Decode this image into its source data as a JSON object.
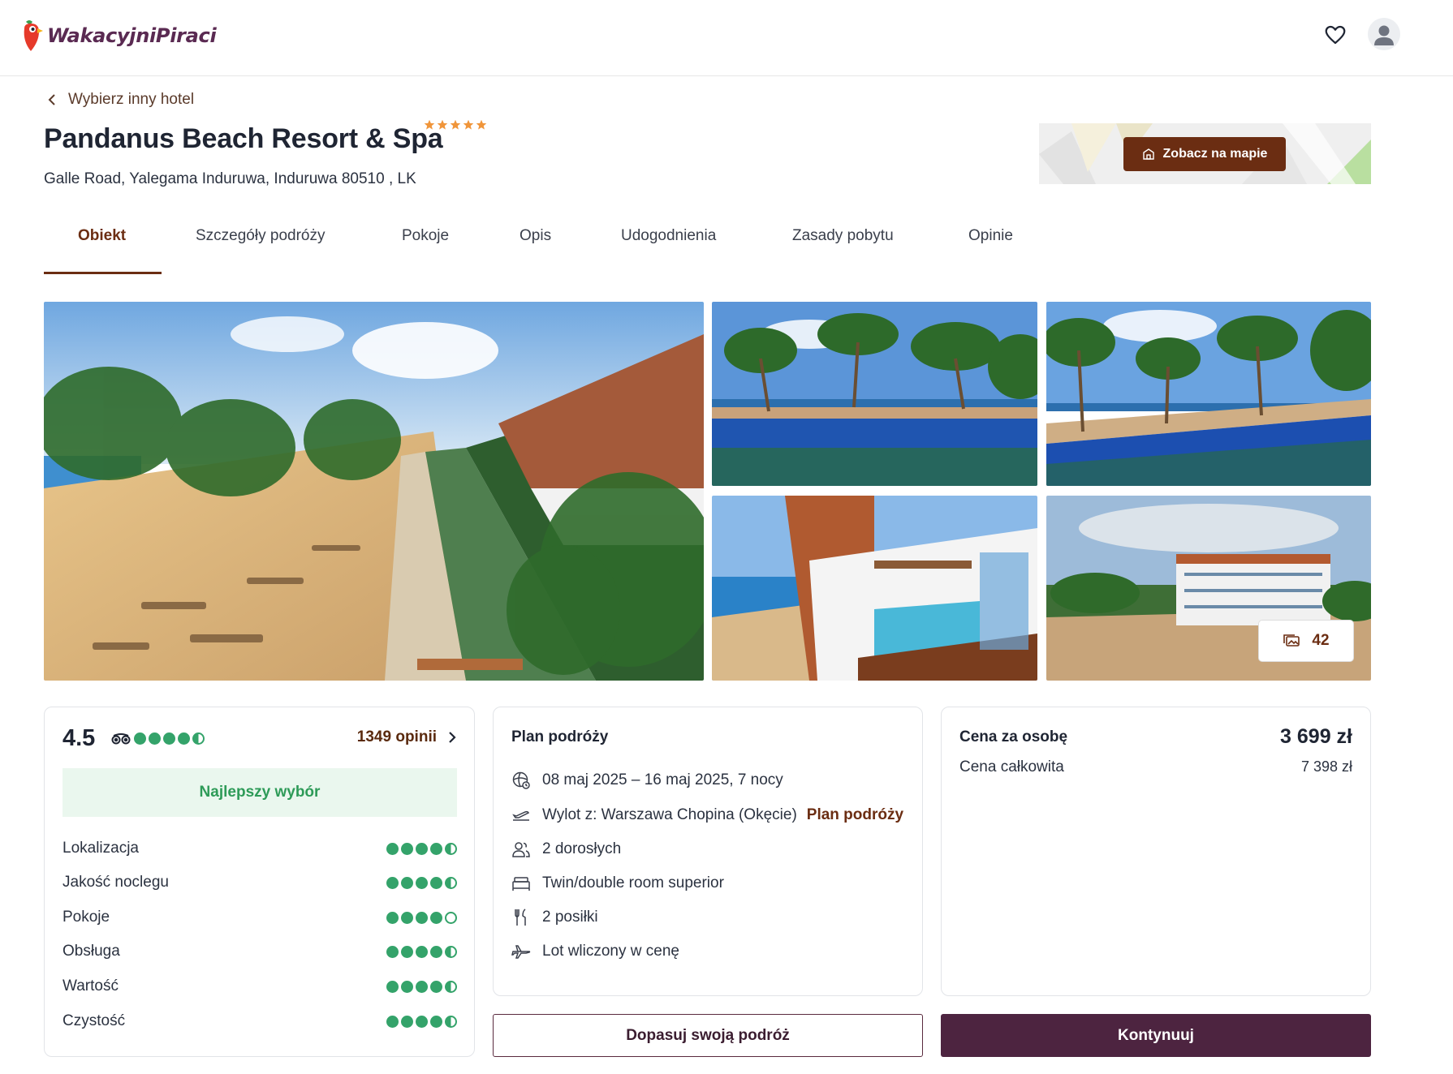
{
  "header": {
    "logo_text": "WakacyjniPiraci",
    "icons": {
      "favorites": "heart-icon",
      "account": "user-avatar-icon"
    }
  },
  "hotel": {
    "back_label": "Wybierz inny hotel",
    "name": "Pandanus Beach Resort & Spa",
    "stars": 5,
    "address": "Galle Road, Yalegama Induruwa, Induruwa 80510 , LK",
    "map_button_label": "Zobacz na mapie"
  },
  "tabs": [
    {
      "label": "Obiekt",
      "active": true
    },
    {
      "label": "Szczegóły podróży",
      "active": false
    },
    {
      "label": "Pokoje",
      "active": false
    },
    {
      "label": "Opis",
      "active": false
    },
    {
      "label": "Udogodnienia",
      "active": false
    },
    {
      "label": "Zasady pobytu",
      "active": false
    },
    {
      "label": "Opinie",
      "active": false
    }
  ],
  "gallery": {
    "photo_count": "42",
    "photos": [
      "beach-pool-aerial",
      "infinity-pool-palms-1",
      "infinity-pool-palms-2",
      "balcony-plunge-pool",
      "hotel-building-aerial"
    ]
  },
  "rating": {
    "score": "4.5",
    "tripadvisor_bubbles": 4.5,
    "reviews_count": "1349 opinii",
    "badge": "Najlepszy wybór",
    "categories": [
      {
        "label": "Lokalizacja",
        "value": 4.5
      },
      {
        "label": "Jakość noclegu",
        "value": 4.5
      },
      {
        "label": "Pokoje",
        "value": 4
      },
      {
        "label": "Obsługa",
        "value": 4.5
      },
      {
        "label": "Wartość",
        "value": 4.5
      },
      {
        "label": "Czystość",
        "value": 4.5
      }
    ]
  },
  "plan": {
    "title": "Plan podróży",
    "dates": "08 maj 2025 – 16 maj 2025, 7 nocy",
    "departure": "Wylot z: Warszawa Chopina (Okęcie)",
    "departure_link": "Plan podróży",
    "travelers": "2 dorosłych",
    "room": "Twin/double room superior",
    "meals": "2 posiłki",
    "flight": "Lot wliczony w cenę"
  },
  "price": {
    "per_person_label": "Cena za osobę",
    "per_person_value": "3 699 zł",
    "total_label": "Cena całkowita",
    "total_value": "7 398 zł"
  },
  "actions": {
    "customize_label": "Dopasuj swoją podróż",
    "continue_label": "Kontynuuj"
  },
  "colors": {
    "brand": "#6b2d12",
    "primary_button": "#4d2440",
    "rating_green": "#34a36a",
    "star_orange": "#f0953a"
  }
}
